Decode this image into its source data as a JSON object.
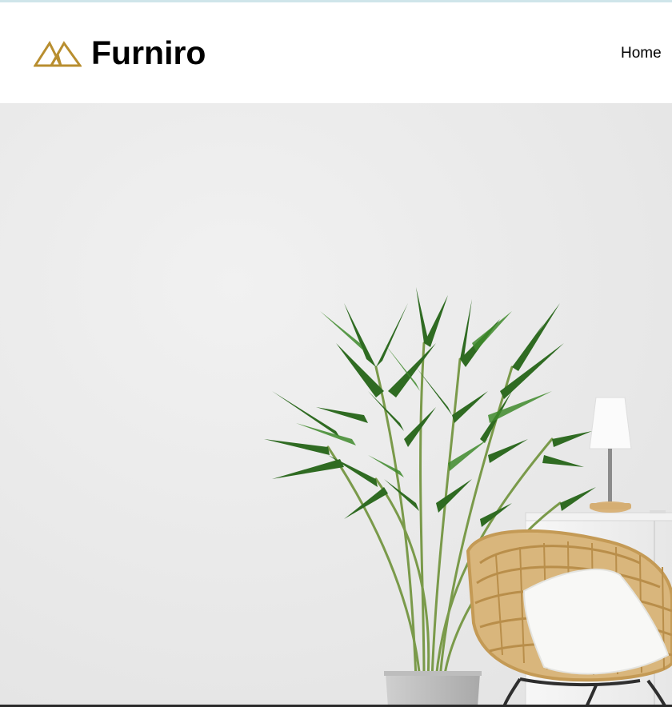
{
  "brand": {
    "name": "Furniro",
    "accent_color": "#b88e2f",
    "logo_icon": "furniro-logo-icon"
  },
  "nav": {
    "items": [
      {
        "label": "Home"
      }
    ]
  },
  "hero": {
    "image": "living-room-plant-rattan-chair-lamp"
  }
}
